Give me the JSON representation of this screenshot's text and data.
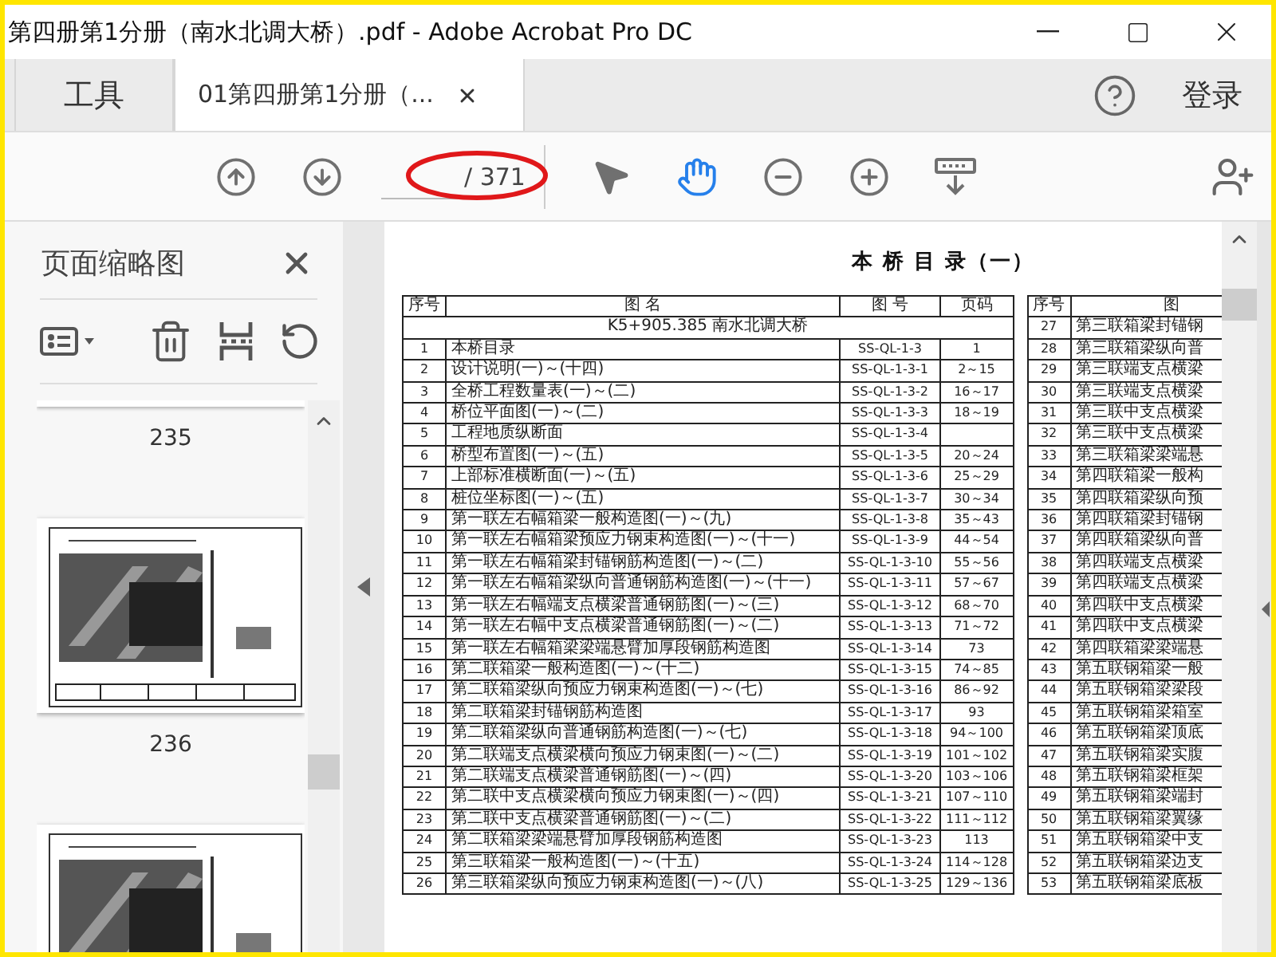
{
  "window": {
    "title": "第四册第1分册（南水北调大桥）.pdf - Adobe Acrobat Pro DC"
  },
  "tabs": [
    {
      "label": "工具",
      "kind": "home",
      "selected": false
    },
    {
      "label": "01第四册第1分册（...",
      "kind": "document",
      "selected": true
    }
  ],
  "account": {
    "sign_in": "登录"
  },
  "toolbar": {
    "page_total": "/ 371",
    "tools": [
      {
        "kind": "select",
        "selected": false
      },
      {
        "kind": "hand",
        "selected": true
      },
      {
        "kind": "zoom-out",
        "selected": false
      },
      {
        "kind": "zoom-in",
        "selected": false
      },
      {
        "kind": "scroll-mode",
        "selected": false
      }
    ]
  },
  "sidebar": {
    "title": "页面缩略图",
    "thumbnails": [
      {
        "kind": "cut",
        "label": "235"
      },
      {
        "kind": "drawing",
        "label": "236"
      },
      {
        "kind": "drawing"
      }
    ]
  },
  "document": {
    "title": "本 桥 目 录（一）",
    "tables": [
      {
        "columns": [
          "序号",
          "图 名",
          "图 号",
          "页码"
        ],
        "section": "K5+905.385 南水北调大桥",
        "rows": [
          [
            "1",
            "本桥目录",
            "SS-QL-1-3",
            "1"
          ],
          [
            "2",
            "设计说明(一)～(十四)",
            "SS-QL-1-3-1",
            "2～15"
          ],
          [
            "3",
            "全桥工程数量表(一)～(二)",
            "SS-QL-1-3-2",
            "16～17"
          ],
          [
            "4",
            "桥位平面图(一)～(二)",
            "SS-QL-1-3-3",
            "18～19"
          ],
          [
            "5",
            "工程地质纵断面",
            "SS-QL-1-3-4",
            ""
          ],
          [
            "6",
            "桥型布置图(一)～(五)",
            "SS-QL-1-3-5",
            "20～24"
          ],
          [
            "7",
            "上部标准横断面(一)～(五)",
            "SS-QL-1-3-6",
            "25～29"
          ],
          [
            "8",
            "桩位坐标图(一)～(五)",
            "SS-QL-1-3-7",
            "30～34"
          ],
          [
            "9",
            "第一联左右幅箱梁一般构造图(一)～(九)",
            "SS-QL-1-3-8",
            "35～43"
          ],
          [
            "10",
            "第一联左右幅箱梁预应力钢束构造图(一)～(十一)",
            "SS-QL-1-3-9",
            "44～54"
          ],
          [
            "11",
            "第一联左右幅箱梁封锚钢筋构造图(一)～(二)",
            "SS-QL-1-3-10",
            "55～56"
          ],
          [
            "12",
            "第一联左右幅箱梁纵向普通钢筋构造图(一)～(十一)",
            "SS-QL-1-3-11",
            "57～67"
          ],
          [
            "13",
            "第一联左右幅端支点横梁普通钢筋图(一)～(三)",
            "SS-QL-1-3-12",
            "68～70"
          ],
          [
            "14",
            "第一联左右幅中支点横梁普通钢筋图(一)～(二)",
            "SS-QL-1-3-13",
            "71～72"
          ],
          [
            "15",
            "第一联左右幅箱梁梁端悬臂加厚段钢筋构造图",
            "SS-QL-1-3-14",
            "73"
          ],
          [
            "16",
            "第二联箱梁一般构造图(一)～(十二)",
            "SS-QL-1-3-15",
            "74～85"
          ],
          [
            "17",
            "第二联箱梁纵向预应力钢束构造图(一)～(七)",
            "SS-QL-1-3-16",
            "86～92"
          ],
          [
            "18",
            "第二联箱梁封锚钢筋构造图",
            "SS-QL-1-3-17",
            "93"
          ],
          [
            "19",
            "第二联箱梁纵向普通钢筋构造图(一)～(七)",
            "SS-QL-1-3-18",
            "94～100"
          ],
          [
            "20",
            "第二联端支点横梁横向预应力钢束图(一)～(二)",
            "SS-QL-1-3-19",
            "101～102"
          ],
          [
            "21",
            "第二联端支点横梁普通钢筋图(一)～(四)",
            "SS-QL-1-3-20",
            "103～106"
          ],
          [
            "22",
            "第二联中支点横梁横向预应力钢束图(一)～(四)",
            "SS-QL-1-3-21",
            "107～110"
          ],
          [
            "23",
            "第二联中支点横梁普通钢筋图(一)～(二)",
            "SS-QL-1-3-22",
            "111～112"
          ],
          [
            "24",
            "第二联箱梁梁端悬臂加厚段钢筋构造图",
            "SS-QL-1-3-23",
            "113"
          ],
          [
            "25",
            "第三联箱梁一般构造图(一)～(十五)",
            "SS-QL-1-3-24",
            "114～128"
          ],
          [
            "26",
            "第三联箱梁纵向预应力钢束构造图(一)～(八)",
            "SS-QL-1-3-25",
            "129～136"
          ]
        ]
      },
      {
        "columns": [
          "序号",
          "图"
        ],
        "rows": [
          [
            "27",
            "第三联箱梁封锚钢"
          ],
          [
            "28",
            "第三联箱梁纵向普"
          ],
          [
            "29",
            "第三联端支点横梁"
          ],
          [
            "30",
            "第三联端支点横梁"
          ],
          [
            "31",
            "第三联中支点横梁"
          ],
          [
            "32",
            "第三联中支点横梁"
          ],
          [
            "33",
            "第三联箱梁梁端悬"
          ],
          [
            "34",
            "第四联箱梁一般构"
          ],
          [
            "35",
            "第四联箱梁纵向预"
          ],
          [
            "36",
            "第四联箱梁封锚钢"
          ],
          [
            "37",
            "第四联箱梁纵向普"
          ],
          [
            "38",
            "第四联端支点横梁"
          ],
          [
            "39",
            "第四联端支点横梁"
          ],
          [
            "40",
            "第四联中支点横梁"
          ],
          [
            "41",
            "第四联中支点横梁"
          ],
          [
            "42",
            "第四联箱梁梁端悬"
          ],
          [
            "43",
            "第五联钢箱梁一般"
          ],
          [
            "44",
            "第五联钢箱梁梁段"
          ],
          [
            "45",
            "第五联钢箱梁箱室"
          ],
          [
            "46",
            "第五联钢箱梁顶底"
          ],
          [
            "47",
            "第五联钢箱梁实腹"
          ],
          [
            "48",
            "第五联钢箱梁框架"
          ],
          [
            "49",
            "第五联钢箱梁端封"
          ],
          [
            "50",
            "第五联钢箱梁翼缘"
          ],
          [
            "51",
            "第五联钢箱梁中支"
          ],
          [
            "52",
            "第五联钢箱梁边支"
          ],
          [
            "53",
            "第五联钢箱梁底板"
          ]
        ]
      }
    ]
  }
}
